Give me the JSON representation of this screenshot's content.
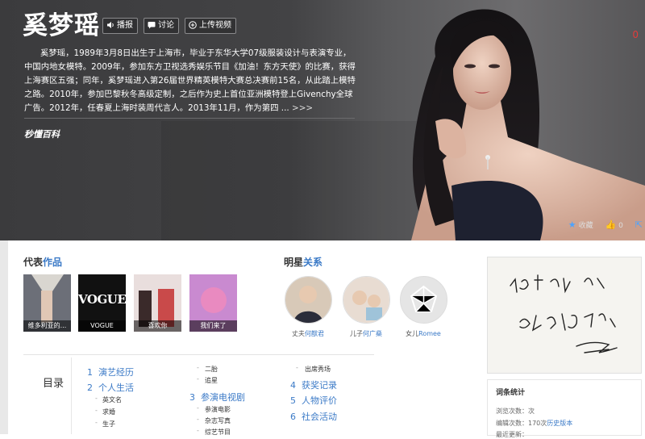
{
  "hero": {
    "title": "奚梦瑶",
    "buttons": [
      {
        "icon": "speaker-icon",
        "label": "播报"
      },
      {
        "icon": "chat-icon",
        "label": "讨论"
      },
      {
        "icon": "plus-circle-icon",
        "label": "上传视频"
      }
    ],
    "summary": "奚梦瑶，1989年3月8日出生于上海市，毕业于东华大学07级服装设计与表演专业，中国内地女模特。2009年，参加东方卫视选秀娱乐节目《加油！东方天使》的比赛，获得上海赛区五强；同年，奚梦瑶进入第26届世界精英模特大赛总决赛前15名，从此踏上模特之路。2010年，参加巴黎秋冬高级定制，之后作为史上首位亚洲模特登上Givenchy全球广告。2012年，任春夏上海时装周代言人。2013年11月，作为第四 ...",
    "more_label": ">>>",
    "brand": "秒懂百科",
    "corner_count": "0",
    "favorite_label": "收藏",
    "like_count": "0",
    "share_icon": "share-icon"
  },
  "works": {
    "title_prefix": "代表",
    "title_highlight": "作品",
    "items": [
      {
        "caption": "维多利亚的..."
      },
      {
        "caption": "VOGUE",
        "logo": "VOGUE"
      },
      {
        "caption": "喜欢你"
      },
      {
        "caption": "我们来了"
      }
    ]
  },
  "relations": {
    "title_prefix": "明星",
    "title_highlight": "关系",
    "items": [
      {
        "role": "丈夫",
        "name": "何猷君"
      },
      {
        "role": "儿子",
        "name": "何广燊"
      },
      {
        "role": "女儿",
        "name": "Romee"
      }
    ]
  },
  "signature": {
    "alt": "签名"
  },
  "stats": {
    "title": "词条统计",
    "views_label": "浏览次数：",
    "views_value": "次",
    "edits_label": "编辑次数：",
    "edits_value": "170次",
    "edits_link": "历史版本",
    "last_update_label": "最近更新："
  },
  "toc": {
    "heading": "目录",
    "col1": [
      {
        "num": "1",
        "label": "演艺经历"
      },
      {
        "num": "2",
        "label": "个人生活"
      }
    ],
    "col1_subs": [
      "英文名",
      "求婚",
      "生子"
    ],
    "col2_subs_top": [
      "二胎",
      "追星"
    ],
    "col2": [
      {
        "num": "3",
        "label": "参演电视剧"
      }
    ],
    "col2_subs": [
      "参演电影",
      "杂志写真",
      "综艺节目"
    ],
    "col3_subs_top": [
      "出席秀场"
    ],
    "col3": [
      {
        "num": "4",
        "label": "获奖记录"
      },
      {
        "num": "5",
        "label": "人物评价"
      },
      {
        "num": "6",
        "label": "社会活动"
      }
    ]
  },
  "colors": {
    "accent": "#3b7ac7",
    "hero_bg": "#424244",
    "alert": "#e23b3b"
  }
}
